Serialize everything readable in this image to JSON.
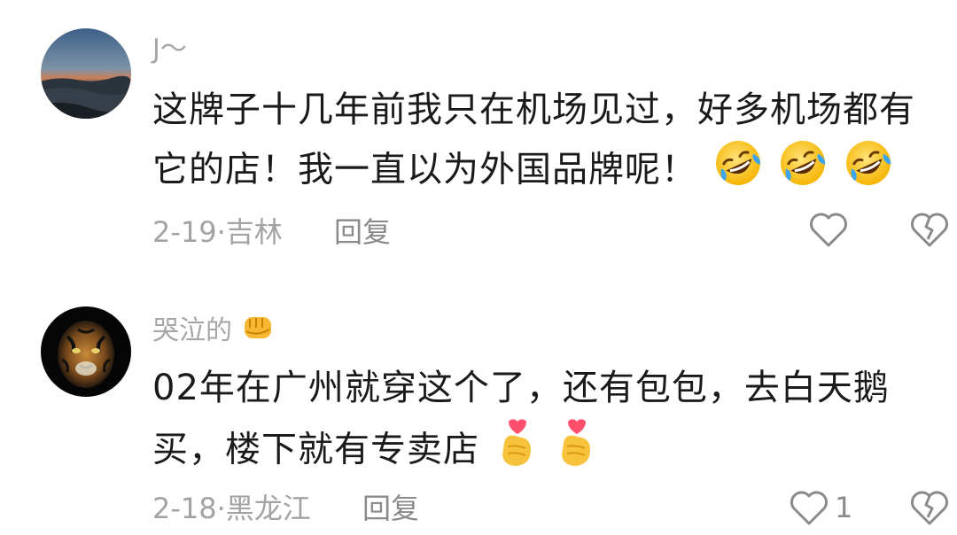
{
  "comments": [
    {
      "username": "J～",
      "avatar_icon": "sunset-sea-avatar",
      "text_line1": "这牌子十几年前我只在机场见过，好多机场都有",
      "text_line2": "它的店！我一直以为外国品牌呢！",
      "emojis": [
        "rofl-emoji",
        "rofl-emoji",
        "rofl-emoji"
      ],
      "date": "2-19",
      "location": "吉林",
      "reply_label": "回复",
      "like_count": "",
      "like_icon": "heart-outline-icon",
      "dislike_icon": "broken-heart-icon"
    },
    {
      "username": "哭泣的",
      "username_emoji": "fist-emoji",
      "avatar_icon": "tiger-avatar",
      "text_line1": "02年在广州就穿这个了，还有包包，去白天鹅",
      "text_line2": "买，楼下就有专卖店",
      "emojis": [
        "finger-heart-emoji",
        "finger-heart-emoji"
      ],
      "date": "2-18",
      "location": "黑龙江",
      "reply_label": "回复",
      "like_count": "1",
      "like_icon": "heart-outline-icon",
      "dislike_icon": "broken-heart-icon"
    }
  ],
  "colors": {
    "username": "#a6a6a6",
    "body_text": "#1a1a1a",
    "meta": "#a3a3a3",
    "icon": "#8a8a8a"
  }
}
